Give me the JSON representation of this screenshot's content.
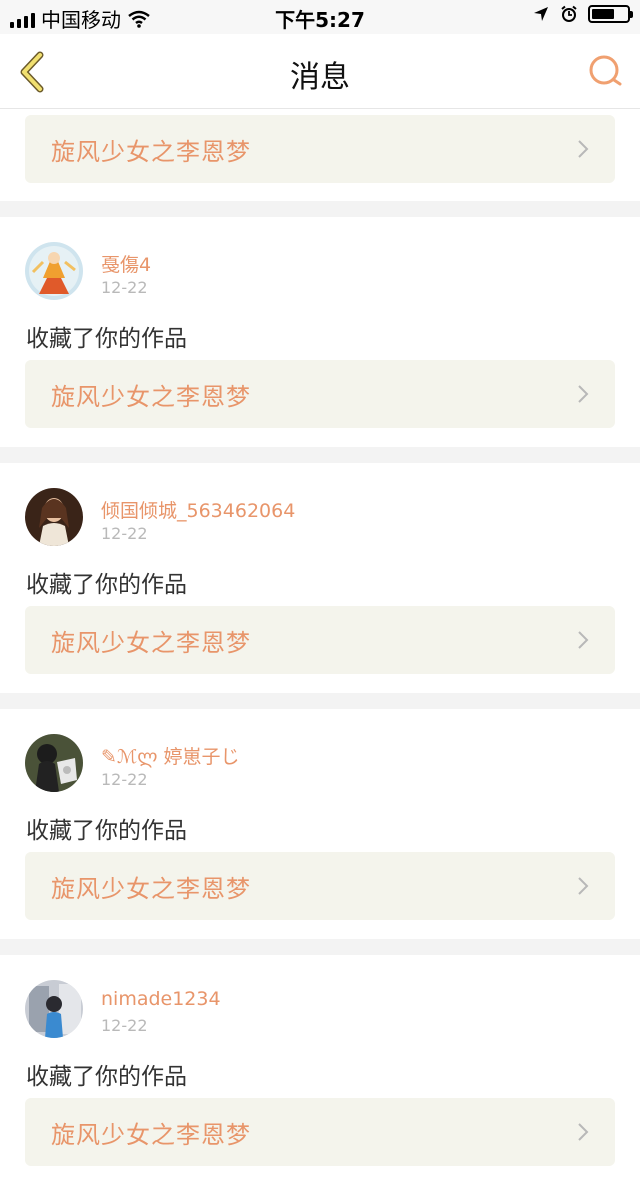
{
  "status_bar": {
    "carrier": "中国移动",
    "time": "下午5:27"
  },
  "nav": {
    "title": "消息",
    "back_icon": "chevron-left-icon",
    "search_icon": "search-icon"
  },
  "colors": {
    "accent": "#e8956a",
    "work_box_bg": "#f4f4ec",
    "divider": "#f3f3f3",
    "date": "#b9b9b9"
  },
  "top_work": {
    "title": "旋风少女之李恩梦"
  },
  "messages": [
    {
      "username": "戞傷4",
      "date": "12-22",
      "action": "收藏了你的作品",
      "work_title": "旋风少女之李恩梦"
    },
    {
      "username": "倾国倾城_563462064",
      "date": "12-22",
      "action": "收藏了你的作品",
      "work_title": "旋风少女之李恩梦"
    },
    {
      "username": "✎ℳლ 婷崽子じ",
      "date": "12-22",
      "action": "收藏了你的作品",
      "work_title": "旋风少女之李恩梦"
    },
    {
      "username": "nimade1234",
      "date": "12-22",
      "action": "收藏了你的作品",
      "work_title": "旋风少女之李恩梦"
    }
  ]
}
